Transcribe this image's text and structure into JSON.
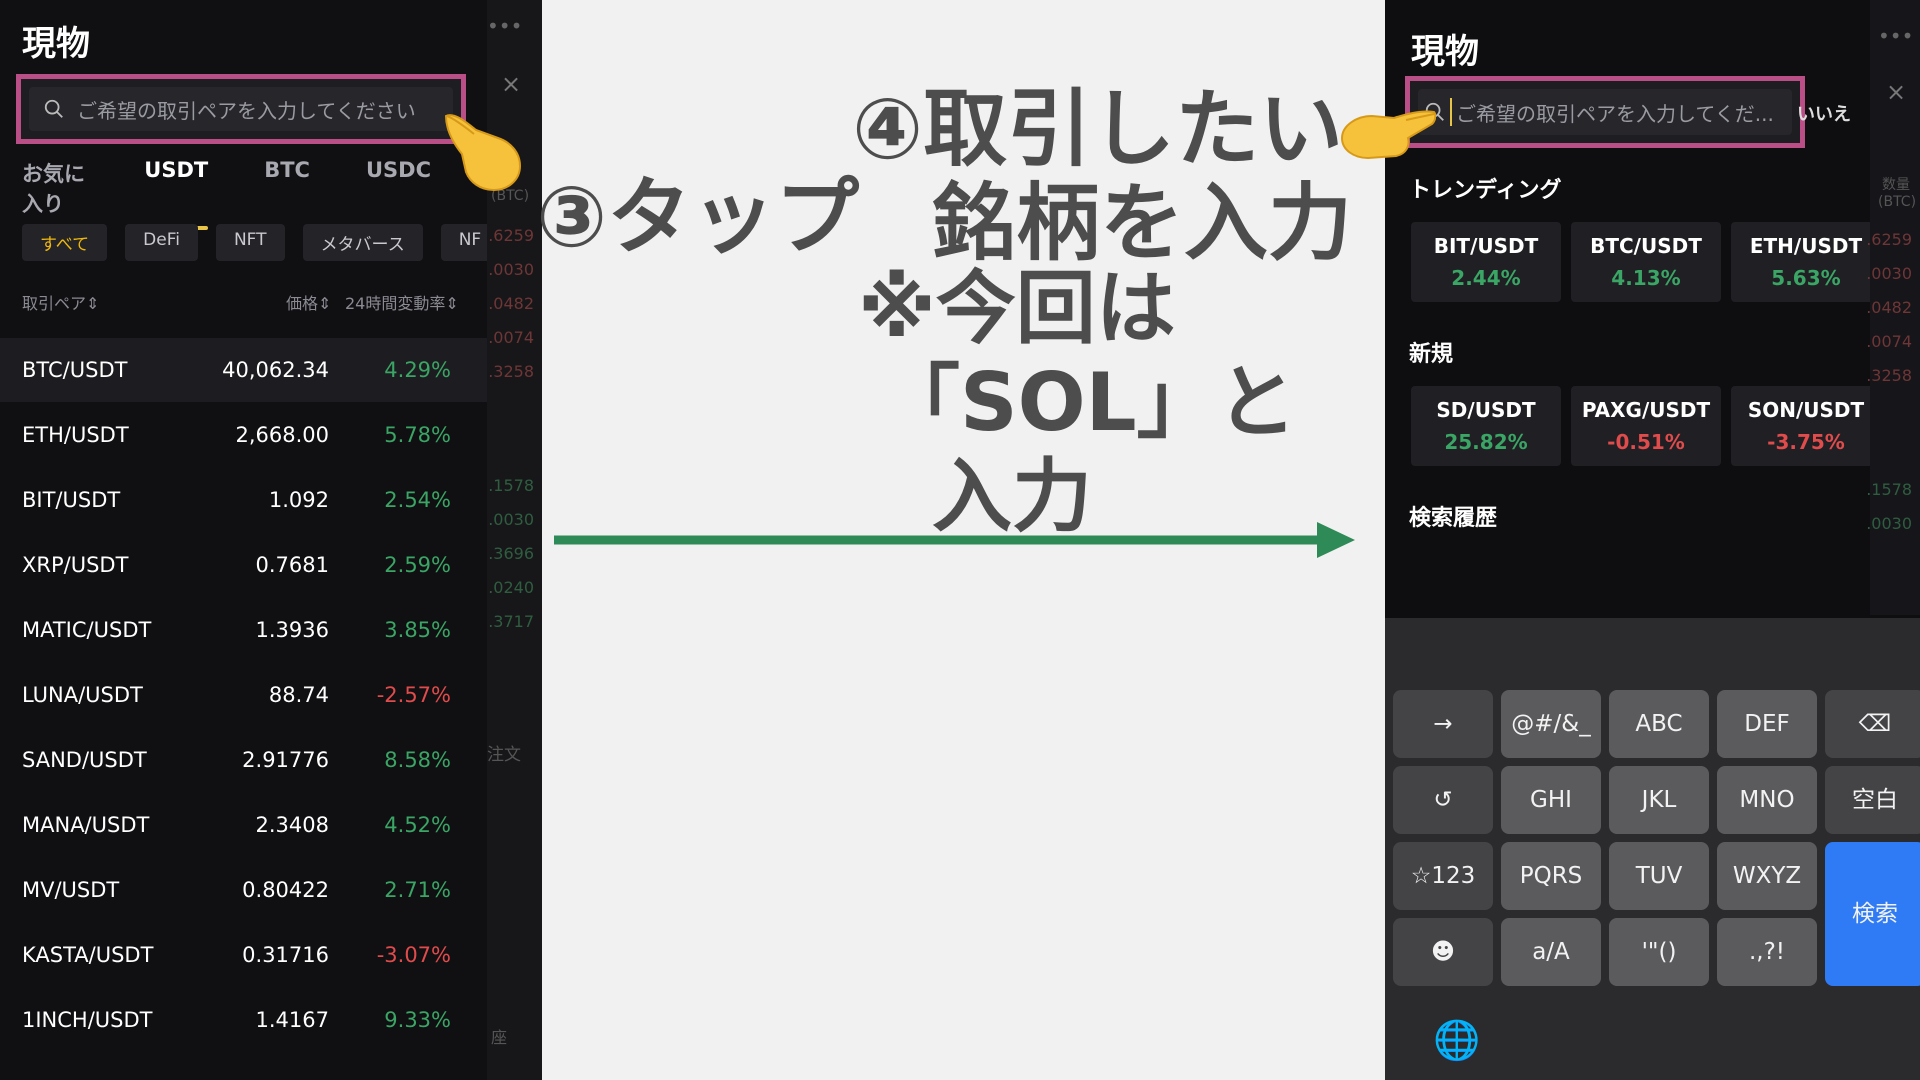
{
  "left_screen": {
    "title": "現物",
    "search_placeholder": "ご希望の取引ペアを入力してください",
    "tabs": [
      {
        "label": "お気に入り",
        "active": false
      },
      {
        "label": "USDT",
        "active": true
      },
      {
        "label": "BTC",
        "active": false
      },
      {
        "label": "USDC",
        "active": false
      }
    ],
    "chips": [
      {
        "label": "すべて",
        "active": true
      },
      {
        "label": "DeFi",
        "active": false
      },
      {
        "label": "NFT",
        "active": false
      },
      {
        "label": "メタバース",
        "active": false
      },
      {
        "label": "NF",
        "active": false
      }
    ],
    "column_headers": {
      "pair": "取引ペア⇕",
      "price": "価格⇕",
      "change": "24時間変動率⇕"
    },
    "rows": [
      {
        "pair": "BTC/USDT",
        "price": "40,062.34",
        "change": "4.29%",
        "dir": "up"
      },
      {
        "pair": "ETH/USDT",
        "price": "2,668.00",
        "change": "5.78%",
        "dir": "up"
      },
      {
        "pair": "BIT/USDT",
        "price": "1.092",
        "change": "2.54%",
        "dir": "up"
      },
      {
        "pair": "XRP/USDT",
        "price": "0.7681",
        "change": "2.59%",
        "dir": "up"
      },
      {
        "pair": "MATIC/USDT",
        "price": "1.3936",
        "change": "3.85%",
        "dir": "up"
      },
      {
        "pair": "LUNA/USDT",
        "price": "88.74",
        "change": "-2.57%",
        "dir": "down"
      },
      {
        "pair": "SAND/USDT",
        "price": "2.91776",
        "change": "8.58%",
        "dir": "up"
      },
      {
        "pair": "MANA/USDT",
        "price": "2.3408",
        "change": "4.52%",
        "dir": "up"
      },
      {
        "pair": "MV/USDT",
        "price": "0.80422",
        "change": "2.71%",
        "dir": "up"
      },
      {
        "pair": "KASTA/USDT",
        "price": "0.31716",
        "change": "-3.07%",
        "dir": "down"
      },
      {
        "pair": "1INCH/USDT",
        "price": "1.4167",
        "change": "9.33%",
        "dir": "up"
      }
    ],
    "edge": {
      "dots": "•••",
      "close": "×",
      "btc_label": "(BTC)",
      "values": [
        ".6259",
        ".0030",
        ".0482",
        ".0074",
        ".3258",
        ".1578",
        ".0030",
        ".3696",
        ".0240",
        ".3717"
      ],
      "order_label": "注文",
      "account_label": "座"
    }
  },
  "annotations": {
    "step3": "③タップ",
    "step4_line1": "④取引したい",
    "step4_line2": "銘柄を入力",
    "note_line1": "※今回は",
    "note_line2": "「SOL」と",
    "note_line3": "入力"
  },
  "right_screen": {
    "title": "現物",
    "search_placeholder": "ご希望の取引ペアを入力してくだ...",
    "cancel_label": "いいえ",
    "trending_title": "トレンディング",
    "trending": [
      {
        "pair": "BIT/USDT",
        "change": "2.44%",
        "dir": "up"
      },
      {
        "pair": "BTC/USDT",
        "change": "4.13%",
        "dir": "up"
      },
      {
        "pair": "ETH/USDT",
        "change": "5.63%",
        "dir": "up"
      }
    ],
    "new_title": "新規",
    "new_listings": [
      {
        "pair": "SD/USDT",
        "change": "25.82%",
        "dir": "up"
      },
      {
        "pair": "PAXG/USDT",
        "change": "-0.51%",
        "dir": "down"
      },
      {
        "pair": "SON/USDT",
        "change": "-3.75%",
        "dir": "down"
      }
    ],
    "history_title": "検索履歴",
    "edge": {
      "dots": "•••",
      "close": "×",
      "qty_label": "数量",
      "btc_label": "(BTC)",
      "values": [
        ".6259",
        ".0030",
        ".0482",
        ".0074",
        ".3258",
        ".1578",
        ".0030"
      ]
    }
  },
  "keyboard": {
    "rows": [
      [
        "→",
        "@#/&_",
        "ABC",
        "DEF",
        "⌫"
      ],
      [
        "↺",
        "GHI",
        "JKL",
        "MNO",
        "空白"
      ],
      [
        "☆123",
        "PQRS",
        "TUV",
        "WXYZ"
      ],
      [
        "☻",
        "a/A",
        "'\"()",
        ".,?!"
      ]
    ],
    "search_key": "検索",
    "globe": "🌐"
  },
  "colors": {
    "highlight_border": "#b94f86",
    "arrow": "#2e8b57",
    "up": "#3aa564",
    "down": "#e04b4b",
    "tab_underline": "#e8c547"
  }
}
